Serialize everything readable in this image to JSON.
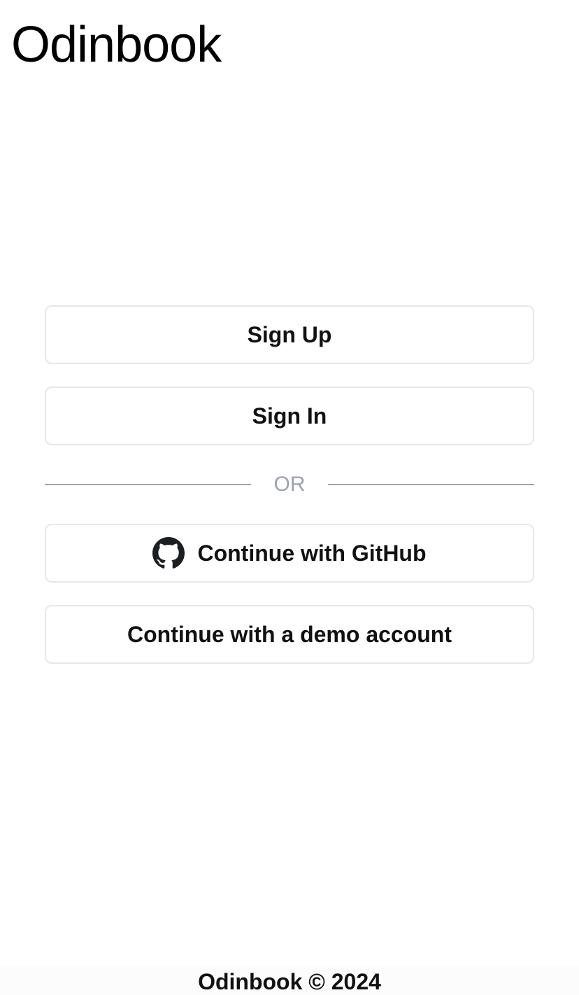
{
  "header": {
    "title": "Odinbook"
  },
  "auth": {
    "sign_up_label": "Sign Up",
    "sign_in_label": "Sign In",
    "divider_text": "OR",
    "github_label": "Continue with GitHub",
    "github_icon": "github-icon",
    "demo_label": "Continue with a demo account"
  },
  "footer": {
    "text": "Odinbook © 2024"
  },
  "colors": {
    "border": "#e5e7eb",
    "divider": "#9ca3af",
    "text": "#111111"
  }
}
